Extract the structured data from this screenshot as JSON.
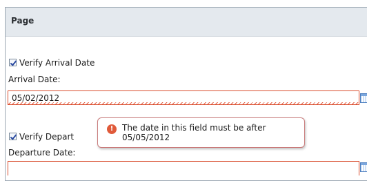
{
  "panel": {
    "title": "Page"
  },
  "arrival": {
    "checkbox_label": "Verify Arrival Date",
    "field_label": "Arrival Date:",
    "value": "05/02/2012"
  },
  "departure": {
    "checkbox_label_visible": "Verify Depart",
    "field_label": "Departure Date:",
    "value": ""
  },
  "validation": {
    "message": "The date in this field must be after\n05/05/2012",
    "icon": "error-exclamation-icon",
    "error_color": "#d94b2b"
  }
}
